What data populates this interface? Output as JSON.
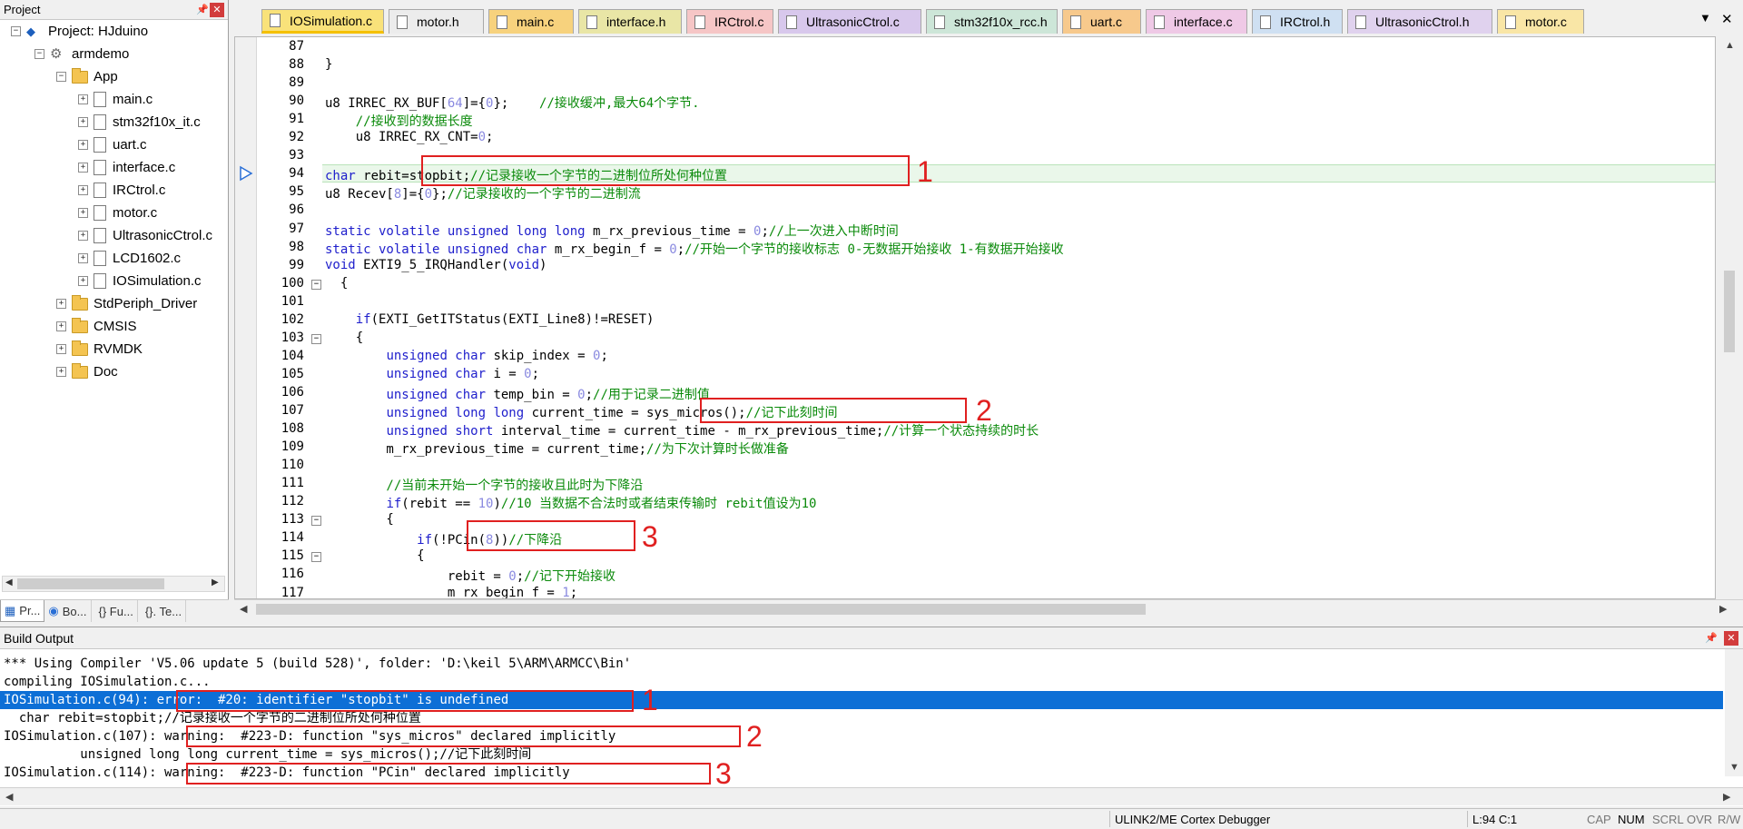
{
  "project_panel": {
    "title": "Project",
    "pin_glyph": "📌",
    "close_glyph": "✕",
    "tree": [
      {
        "label": "Project: HJduino",
        "type": "project",
        "expand": "−"
      },
      {
        "label": "armdemo",
        "type": "target",
        "expand": "−"
      },
      {
        "label": "App",
        "type": "folder-open",
        "expand": "−"
      },
      {
        "label": "main.c",
        "type": "file",
        "expand": "+"
      },
      {
        "label": "stm32f10x_it.c",
        "type": "file",
        "expand": "+"
      },
      {
        "label": "uart.c",
        "type": "file",
        "expand": "+"
      },
      {
        "label": "interface.c",
        "type": "file",
        "expand": "+"
      },
      {
        "label": "IRCtrol.c",
        "type": "file",
        "expand": "+"
      },
      {
        "label": "motor.c",
        "type": "file",
        "expand": "+"
      },
      {
        "label": "UltrasonicCtrol.c",
        "type": "file",
        "expand": "+"
      },
      {
        "label": "LCD1602.c",
        "type": "file",
        "expand": "+"
      },
      {
        "label": "IOSimulation.c",
        "type": "file",
        "expand": "+"
      },
      {
        "label": "StdPeriph_Driver",
        "type": "folder",
        "expand": "+"
      },
      {
        "label": "CMSIS",
        "type": "folder",
        "expand": "+"
      },
      {
        "label": "RVMDK",
        "type": "folder",
        "expand": "+"
      },
      {
        "label": "Doc",
        "type": "folder",
        "expand": "+"
      }
    ],
    "bottom_tabs": [
      {
        "label": "Pr...",
        "icon": "project-icon"
      },
      {
        "label": "Bo...",
        "icon": "books-icon"
      },
      {
        "label": "{} Fu...",
        "icon": "functions-icon"
      },
      {
        "label": "{}. Te...",
        "icon": "templates-icon"
      }
    ]
  },
  "editor_tabs": [
    {
      "label": "IOSimulation.c",
      "color": "#f9e27a",
      "active": true
    },
    {
      "label": "motor.h",
      "color": "#ececec"
    },
    {
      "label": "main.c",
      "color": "#f7d27d"
    },
    {
      "label": "interface.h",
      "color": "#e9e6a6"
    },
    {
      "label": "IRCtrol.c",
      "color": "#f6c6c6"
    },
    {
      "label": "UltrasonicCtrol.c",
      "color": "#d8c8ec"
    },
    {
      "label": "stm32f10x_rcc.h",
      "color": "#cde6d8"
    },
    {
      "label": "uart.c",
      "color": "#f7c98c"
    },
    {
      "label": "interface.c",
      "color": "#efc9e6"
    },
    {
      "label": "IRCtrol.h",
      "color": "#cfe0f2"
    },
    {
      "label": "UltrasonicCtrol.h",
      "color": "#e0d2ee"
    },
    {
      "label": "motor.c",
      "color": "#f9e6a6"
    }
  ],
  "tab_menu_glyph": "▼",
  "tab_close_glyph": "✕",
  "editor": {
    "current_line": 94,
    "lines": [
      {
        "n": "87",
        "fold": "",
        "tokens": [
          [
            "",
            "  "
          ]
        ]
      },
      {
        "n": "88",
        "fold": "",
        "tokens": [
          [
            "",
            "}"
          ]
        ]
      },
      {
        "n": "89",
        "fold": "",
        "tokens": [
          [
            "",
            ""
          ]
        ]
      },
      {
        "n": "90",
        "fold": "",
        "tokens": [
          [
            "",
            "u8 IRREC_RX_BUF["
          ],
          [
            "num",
            "64"
          ],
          [
            "",
            "]={"
          ],
          [
            "num",
            "0"
          ],
          [
            "",
            "};    "
          ],
          [
            "cm",
            "//接收缓冲,最大64个字节."
          ]
        ]
      },
      {
        "n": "91",
        "fold": "",
        "tokens": [
          [
            "cm",
            "    //接收到的数据长度"
          ]
        ]
      },
      {
        "n": "92",
        "fold": "",
        "tokens": [
          [
            "",
            "    u8 IRREC_RX_CNT="
          ],
          [
            "num",
            "0"
          ],
          [
            "",
            ";"
          ]
        ]
      },
      {
        "n": "93",
        "fold": "",
        "tokens": [
          [
            "",
            ""
          ]
        ]
      },
      {
        "n": "94",
        "fold": "",
        "tokens": [
          [
            "kw",
            "char"
          ],
          [
            "",
            " rebit=stopbit;"
          ],
          [
            "cm",
            "//记录接收一个字节的二进制位所处何种位置"
          ]
        ]
      },
      {
        "n": "95",
        "fold": "",
        "tokens": [
          [
            "",
            "u8 Recev["
          ],
          [
            "num",
            "8"
          ],
          [
            "",
            "]={"
          ],
          [
            "num",
            "0"
          ],
          [
            "",
            "};"
          ],
          [
            "cm",
            "//记录接收的一个字节的二进制流"
          ]
        ]
      },
      {
        "n": "96",
        "fold": "",
        "tokens": [
          [
            "",
            ""
          ]
        ]
      },
      {
        "n": "97",
        "fold": "",
        "tokens": [
          [
            "kw",
            "static volatile unsigned long long"
          ],
          [
            "",
            " m_rx_previous_time = "
          ],
          [
            "num",
            "0"
          ],
          [
            "",
            ";"
          ],
          [
            "cm",
            "//上一次进入中断时间"
          ]
        ]
      },
      {
        "n": "98",
        "fold": "",
        "tokens": [
          [
            "kw",
            "static volatile unsigned char"
          ],
          [
            "",
            " m_rx_begin_f = "
          ],
          [
            "num",
            "0"
          ],
          [
            "",
            ";"
          ],
          [
            "cm",
            "//开始一个字节的接收标志 0-无数据开始接收 1-有数据开始接收"
          ]
        ]
      },
      {
        "n": "99",
        "fold": "",
        "tokens": [
          [
            "kw",
            "void"
          ],
          [
            "",
            " EXTI9_5_IRQHandler("
          ],
          [
            "kw",
            "void"
          ],
          [
            "",
            ")"
          ]
        ]
      },
      {
        "n": "100",
        "fold": "−",
        "tokens": [
          [
            "",
            "  {"
          ]
        ]
      },
      {
        "n": "101",
        "fold": "",
        "tokens": [
          [
            "",
            ""
          ]
        ]
      },
      {
        "n": "102",
        "fold": "",
        "tokens": [
          [
            "",
            "    "
          ],
          [
            "kw",
            "if"
          ],
          [
            "",
            "(EXTI_GetITStatus(EXTI_Line8)!=RESET)"
          ]
        ]
      },
      {
        "n": "103",
        "fold": "−",
        "tokens": [
          [
            "",
            "    {"
          ]
        ]
      },
      {
        "n": "104",
        "fold": "",
        "tokens": [
          [
            "",
            "        "
          ],
          [
            "kw",
            "unsigned char"
          ],
          [
            "",
            " skip_index = "
          ],
          [
            "num",
            "0"
          ],
          [
            "",
            ";"
          ]
        ]
      },
      {
        "n": "105",
        "fold": "",
        "tokens": [
          [
            "",
            "        "
          ],
          [
            "kw",
            "unsigned char"
          ],
          [
            "",
            " i = "
          ],
          [
            "num",
            "0"
          ],
          [
            "",
            ";"
          ]
        ]
      },
      {
        "n": "106",
        "fold": "",
        "tokens": [
          [
            "",
            "        "
          ],
          [
            "kw",
            "unsigned char"
          ],
          [
            "",
            " temp_bin = "
          ],
          [
            "num",
            "0"
          ],
          [
            "",
            ";"
          ],
          [
            "cm",
            "//用于记录二进制值"
          ]
        ]
      },
      {
        "n": "107",
        "fold": "",
        "tokens": [
          [
            "",
            "        "
          ],
          [
            "kw",
            "unsigned long long"
          ],
          [
            "",
            " current_time = sys_micros();"
          ],
          [
            "cm",
            "//记下此刻时间"
          ]
        ]
      },
      {
        "n": "108",
        "fold": "",
        "tokens": [
          [
            "",
            "        "
          ],
          [
            "kw",
            "unsigned short"
          ],
          [
            "",
            " interval_time = current_time - m_rx_previous_time;"
          ],
          [
            "cm",
            "//计算一个状态持续的时长"
          ]
        ]
      },
      {
        "n": "109",
        "fold": "",
        "tokens": [
          [
            "",
            "        m_rx_previous_time = current_time;"
          ],
          [
            "cm",
            "//为下次计算时长做准备"
          ]
        ]
      },
      {
        "n": "110",
        "fold": "",
        "tokens": [
          [
            "",
            ""
          ]
        ]
      },
      {
        "n": "111",
        "fold": "",
        "tokens": [
          [
            "cm",
            "        //当前未开始一个字节的接收且此时为下降沿"
          ]
        ]
      },
      {
        "n": "112",
        "fold": "",
        "tokens": [
          [
            "",
            "        "
          ],
          [
            "kw",
            "if"
          ],
          [
            "",
            "(rebit == "
          ],
          [
            "num",
            "10"
          ],
          [
            "",
            ")"
          ],
          [
            "cm",
            "//10 当数据不合法时或者结束传输时 rebit值设为10"
          ]
        ]
      },
      {
        "n": "113",
        "fold": "−",
        "tokens": [
          [
            "",
            "        {"
          ]
        ]
      },
      {
        "n": "114",
        "fold": "",
        "tokens": [
          [
            "",
            "            "
          ],
          [
            "kw",
            "if"
          ],
          [
            "",
            "(!PCin("
          ],
          [
            "num",
            "8"
          ],
          [
            "",
            "))"
          ],
          [
            "cm",
            "//下降沿"
          ]
        ]
      },
      {
        "n": "115",
        "fold": "−",
        "tokens": [
          [
            "",
            "            {"
          ]
        ]
      },
      {
        "n": "116",
        "fold": "",
        "tokens": [
          [
            "",
            "                rebit = "
          ],
          [
            "num",
            "0"
          ],
          [
            "",
            ";"
          ],
          [
            "cm",
            "//记下开始接收"
          ]
        ]
      },
      {
        "n": "117",
        "fold": "",
        "tokens": [
          [
            "",
            "                m_rx_begin_f = "
          ],
          [
            "num",
            "1"
          ],
          [
            "",
            ";"
          ]
        ]
      }
    ]
  },
  "annotations": [
    "1",
    "2",
    "3"
  ],
  "build_output": {
    "title": "Build Output",
    "lines": [
      "*** Using Compiler 'V5.06 update 5 (build 528)', folder: 'D:\\keil 5\\ARM\\ARMCC\\Bin'",
      "compiling IOSimulation.c...",
      "IOSimulation.c(94): error:  #20: identifier \"stopbit\" is undefined",
      "  char rebit=stopbit;//记录接收一个字节的二进制位所处何种位置",
      "IOSimulation.c(107): warning:  #223-D: function \"sys_micros\" declared implicitly",
      "          unsigned long long current_time = sys_micros();//记下此刻时间",
      "IOSimulation.c(114): warning:  #223-D: function \"PCin\" declared implicitly"
    ],
    "selected_line": 2
  },
  "status_bar": {
    "debugger": "ULINK2/ME Cortex Debugger",
    "position": "L:94 C:1",
    "indicators": [
      {
        "label": "CAP",
        "on": false
      },
      {
        "label": "NUM",
        "on": true
      },
      {
        "label": "SCRL",
        "on": false
      },
      {
        "label": "OVR",
        "on": false
      },
      {
        "label": "R/W",
        "on": false
      }
    ]
  },
  "colors": {
    "selection": "#0d6fd6",
    "annotation": "#e02020",
    "comment": "#0a8a0a",
    "keyword": "#1e1ecc"
  }
}
